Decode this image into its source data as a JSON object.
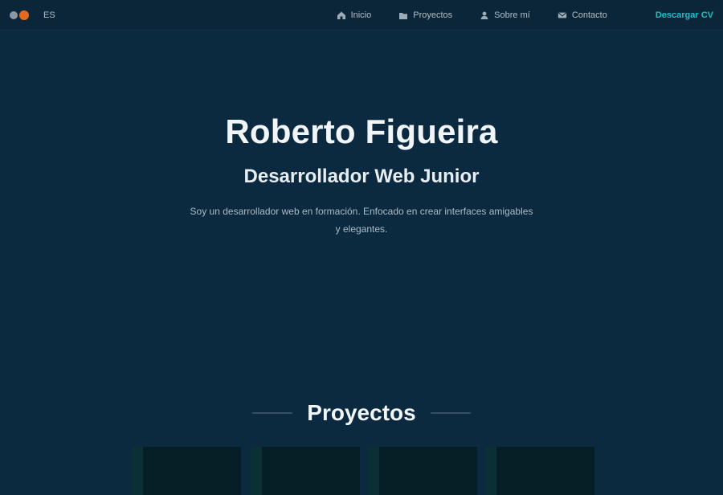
{
  "topbar": {
    "lang_label": "ES",
    "nav": [
      {
        "icon": "home-icon",
        "label": "Inicio"
      },
      {
        "icon": "folder-icon",
        "label": "Proyectos"
      },
      {
        "icon": "user-icon",
        "label": "Sobre mí"
      },
      {
        "icon": "mail-icon",
        "label": "Contacto"
      }
    ],
    "cta_label": "Descargar CV"
  },
  "hero": {
    "name": "Roberto Figueira",
    "role": "Desarrollador Web Junior",
    "description": "Soy un desarrollador web en formación. Enfocado en crear interfaces amigables y elegantes."
  },
  "projects": {
    "title": "Proyectos",
    "cards_count_label": ""
  },
  "colors": {
    "background": "#0b2a3f",
    "topbar": "#0a2638",
    "accent": "#19c1c9",
    "brand_orange": "#e46a1f",
    "card_bg": "#061e26"
  }
}
